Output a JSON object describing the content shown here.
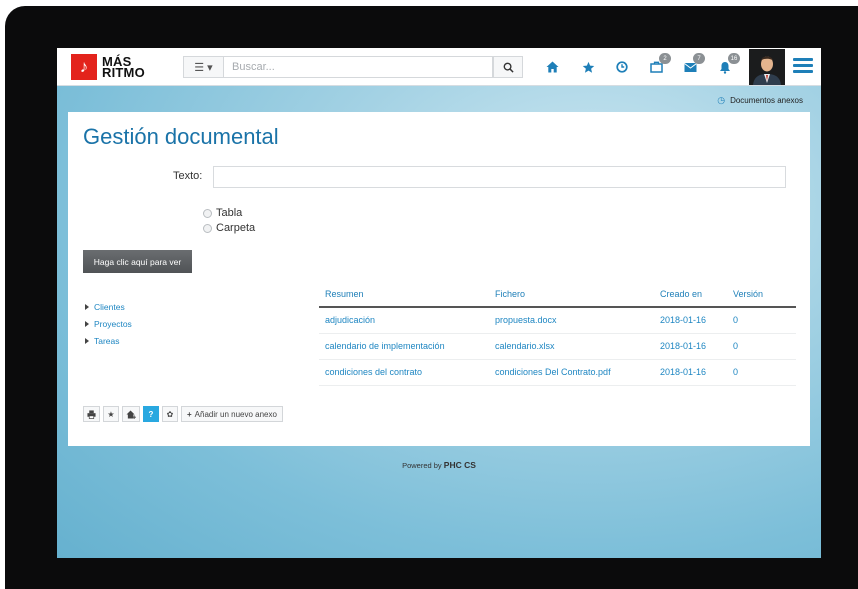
{
  "brand": {
    "line1": "MÁS",
    "line2": "RITMO",
    "mark": "♪"
  },
  "search": {
    "type_icon": "list-icon",
    "placeholder": "Buscar...",
    "button_icon": "search-icon"
  },
  "nav": {
    "icons": [
      {
        "name": "home-icon",
        "glyph": "⌂"
      },
      {
        "name": "star-icon",
        "glyph": "★"
      },
      {
        "name": "clock-icon",
        "glyph": "◷"
      },
      {
        "name": "briefcase-icon",
        "glyph": "▣",
        "badge": "2"
      },
      {
        "name": "mail-icon",
        "glyph": "✉",
        "badge": "7"
      },
      {
        "name": "bell-icon",
        "glyph": "🔔",
        "badge": "16"
      }
    ]
  },
  "breadcrumb": {
    "label": "Documentos anexos"
  },
  "page": {
    "title": "Gestión documental",
    "texto_label": "Texto:",
    "texto_value": "",
    "view_options": [
      "Tabla",
      "Carpeta"
    ],
    "view_button": "Haga clic aquí para ver"
  },
  "tree": [
    "Clientes",
    "Proyectos",
    "Tareas"
  ],
  "table": {
    "headers": [
      "Resumen",
      "Fichero",
      "Creado en",
      "Versión"
    ],
    "rows": [
      [
        "adjudicación",
        "propuesta.docx",
        "2018-01-16",
        "0"
      ],
      [
        "calendario de implementación",
        "calendario.xlsx",
        "2018-01-16",
        "0"
      ],
      [
        "condiciones del contrato",
        "condiciones Del Contrato.pdf",
        "2018-01-16",
        "0"
      ]
    ]
  },
  "toolbar": {
    "add_label": "Añadir un nuevo anexo"
  },
  "footer": {
    "prefix": "Powered by",
    "brand": "PHC CS"
  },
  "colors": {
    "accent": "#1e7fb8",
    "brand_red": "#e3231c",
    "help_blue": "#29a8e0"
  }
}
